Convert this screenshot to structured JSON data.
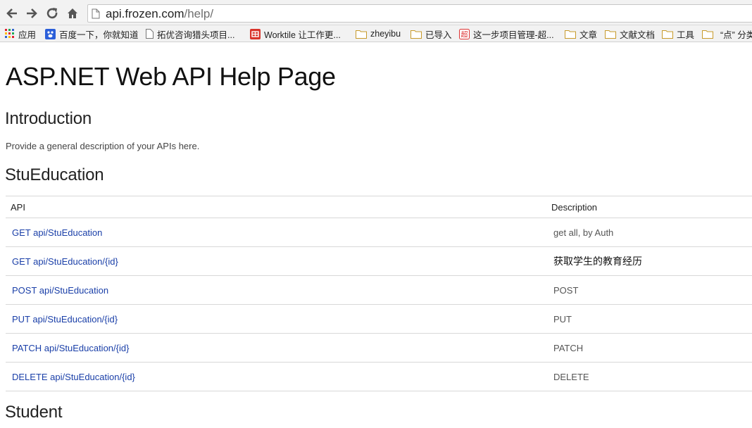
{
  "browser": {
    "url_host": "api.frozen.com",
    "url_path": "/help/"
  },
  "bookmarks": [
    {
      "label": "应用",
      "icon": "apps-grid-icon"
    },
    {
      "label": "百度一下，你就知道",
      "icon": "baidu-paw-icon"
    },
    {
      "label": "拓优咨询猎头项目...",
      "icon": "page-icon"
    },
    {
      "label": "Worktile 让工作更...",
      "icon": "worktile-icon"
    },
    {
      "label": "zheyibu",
      "icon": "folder-icon"
    },
    {
      "label": "已导入",
      "icon": "folder-icon"
    },
    {
      "label": "这一步项目管理-超...",
      "icon": "chao-icon"
    },
    {
      "label": "文章",
      "icon": "folder-icon"
    },
    {
      "label": "文献文档",
      "icon": "folder-icon"
    },
    {
      "label": "工具",
      "icon": "folder-icon"
    },
    {
      "label": "“点” 分类",
      "icon": "folder-icon"
    }
  ],
  "page": {
    "title": "ASP.NET Web API Help Page",
    "intro_heading": "Introduction",
    "intro_text": "Provide a general description of your APIs here.",
    "sections": [
      {
        "name": "StuEducation",
        "columns": {
          "api": "API",
          "description": "Description"
        },
        "rows": [
          {
            "api": "GET api/StuEducation",
            "description": "get all, by Auth"
          },
          {
            "api": "GET api/StuEducation/{id}",
            "description": "获取学生的教育经历"
          },
          {
            "api": "POST api/StuEducation",
            "description": "POST"
          },
          {
            "api": "PUT api/StuEducation/{id}",
            "description": "PUT"
          },
          {
            "api": "PATCH api/StuEducation/{id}",
            "description": "PATCH"
          },
          {
            "api": "DELETE api/StuEducation/{id}",
            "description": "DELETE"
          }
        ]
      },
      {
        "name": "Student"
      }
    ]
  },
  "colors": {
    "link": "#1a3fa8",
    "chrome_bg": "#f2f2f2",
    "border": "#d8d8d8"
  }
}
